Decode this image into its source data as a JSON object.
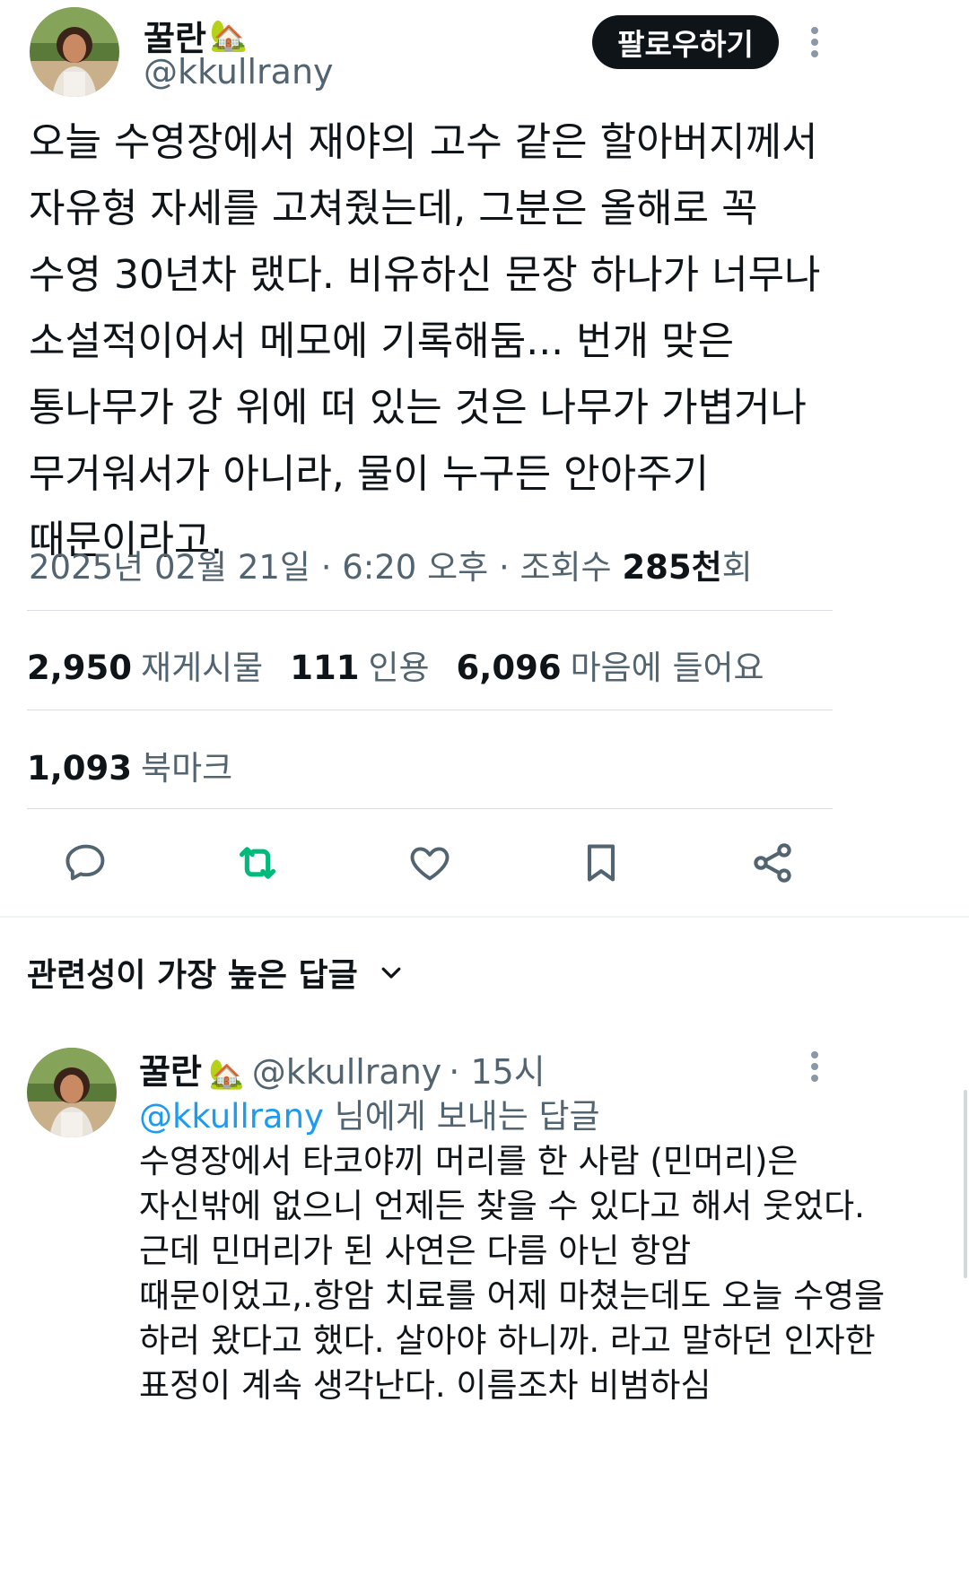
{
  "tweet": {
    "author_name": "꿀란",
    "author_emoji": "🏡",
    "author_handle": "@kkullrany",
    "follow_label": "팔로우하기",
    "body_lines": [
      "오늘 수영장에서 재야의 고수 같은 할아버지께서",
      "자유형 자세를 고쳐줬는데, 그분은 올해로 꼭",
      "수영 30년차 랬다. 비유하신 문장 하나가 너무나",
      "소설적이어서 메모에 기록해둠... 번개 맞은",
      "통나무가 강 위에 떠 있는 것은 나무가 가볍거나",
      "무거워서가 아니라, 물이 누구든 안아주기",
      "때문이라고."
    ],
    "timestamp": "2025년 02월 21일 · 6:20 오후 · 조회수 ",
    "views_value": "285천",
    "views_suffix": "회"
  },
  "stats": {
    "reposts_value": "2,950",
    "reposts_label": "재게시물",
    "quotes_value": "111",
    "quotes_label": "인용",
    "likes_value": "6,096",
    "likes_label": "마음에 들어요",
    "bookmarks_value": "1,093",
    "bookmarks_label": "북마크"
  },
  "actions": {
    "reply_icon": "speech-bubble",
    "repost_icon": "repost-arrows",
    "like_icon": "heart",
    "bookmark_icon": "bookmark",
    "share_icon": "share-nodes",
    "repost_color": "#00ba7c"
  },
  "replies_section": {
    "sort_label": "관련성이 가장 높은 답글"
  },
  "reply": {
    "author_name": "꿀란",
    "author_emoji": "🏡",
    "author_handle": "@kkullrany",
    "time": "· 15시",
    "replying_to_handle": "@kkullrany",
    "replying_to_suffix": " 님에게 보내는 답글",
    "body_lines": [
      "수영장에서 타코야끼 머리를 한 사람 (민머리)은",
      "자신밖에 없으니 언제든 찾을 수 있다고 해서 웃었다.",
      "근데 민머리가 된 사연은 다름 아닌 항암",
      "때문이었고,.항암 치료를 어제 마쳤는데도 오늘 수영을",
      "하러 왔다고 했다. 살아야 하니까. 라고 말하던 인자한",
      "표정이 계속 생각난다. 이름조차 비범하심"
    ]
  },
  "colors": {
    "text_primary": "#0f1419",
    "text_secondary": "#536471",
    "link": "#1d9bf0",
    "follow_bg": "#0f1419"
  }
}
